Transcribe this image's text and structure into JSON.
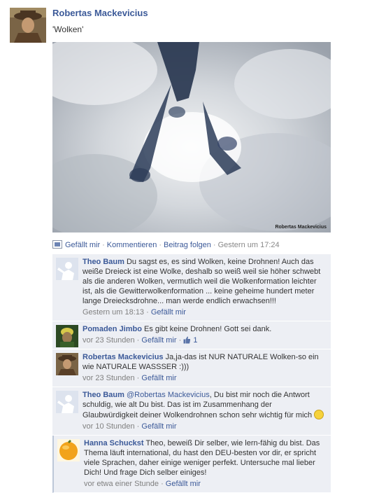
{
  "post": {
    "author": "Robertas Mackevicius",
    "text": "'Wolken'",
    "photo_credit": "Robertas Mackevicius",
    "actions": {
      "like": "Gefällt mir",
      "comment": "Kommentieren",
      "follow": "Beitrag folgen",
      "timestamp": "Gestern um 17:24",
      "separator": "·"
    }
  },
  "comments": [
    {
      "author": "Theo Baum",
      "text": "Du sagst es, es sind Wolken, keine Drohnen! Auch das weiße Dreieck ist eine Wolke, deshalb so weiß weil sie höher schwebt als die anderen Wolken, vermutlich weil die Wolkenformation leichter ist, als die Gewitterwolkenformation ... keine geheime hundert meter lange Dreiecksdrohne... man werde endlich erwachsen!!!",
      "time": "Gestern um 18:13",
      "like": "Gefällt mir",
      "avatar": "silhouette"
    },
    {
      "author": "Pomaden Jimbo",
      "text": "Es gibt keine Drohnen! Gott sei dank.",
      "time": "vor 23 Stunden",
      "like": "Gefällt mir",
      "likes_count": "1",
      "avatar": "photo-green"
    },
    {
      "author": "Robertas Mackevicius",
      "text": "Ja,ja-das ist NUR NATURALE Wolken-so ein wie NATURALE WASSSER :)))",
      "time": "vor 23 Stunden",
      "like": "Gefällt mir",
      "avatar": "photo-brown"
    },
    {
      "author": "Theo Baum",
      "mention": "@Robertas Mackevicius",
      "text": ", Du bist mir noch die Antwort schuldig, wie alt Du bist. Das ist im Zusammenhang der Glaubwürdigkeit deiner Wolkendrohnen schon sehr wichtig für mich",
      "time": "vor 10 Stunden",
      "like": "Gefällt mir",
      "avatar": "silhouette"
    },
    {
      "author": "Hanna Schuckst",
      "text": "Theo, beweiß Dir selber, wie lern-fähig du bist. Das Thema läuft international, du hast den DEU-besten vor dir, er spricht viele Sprachen, daher einige weniger perfekt. Untersuche mal lieber Dich! Und frage Dich selber einiges!",
      "time": "vor etwa einer Stunde",
      "like": "Gefällt mir",
      "avatar": "photo-orange"
    }
  ]
}
